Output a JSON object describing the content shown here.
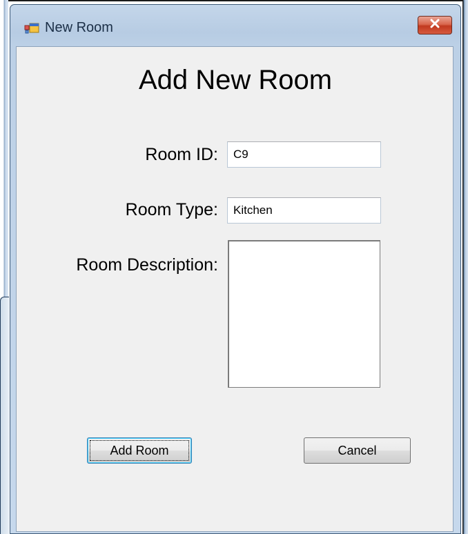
{
  "window": {
    "title": "New Room",
    "icon": "form-app-icon",
    "close_icon": "close-x-icon"
  },
  "form": {
    "heading": "Add New Room",
    "room_id_label": "Room ID:",
    "room_id_value": "C9",
    "room_type_label": "Room Type:",
    "room_type_value": "Kitchen",
    "room_description_label": "Room Description:",
    "room_description_value": ""
  },
  "buttons": {
    "add_label": "Add Room",
    "cancel_label": "Cancel"
  },
  "colors": {
    "titlebar": "#b9cde4",
    "client_bg": "#f0f0f0",
    "close_button": "#c7432a"
  }
}
